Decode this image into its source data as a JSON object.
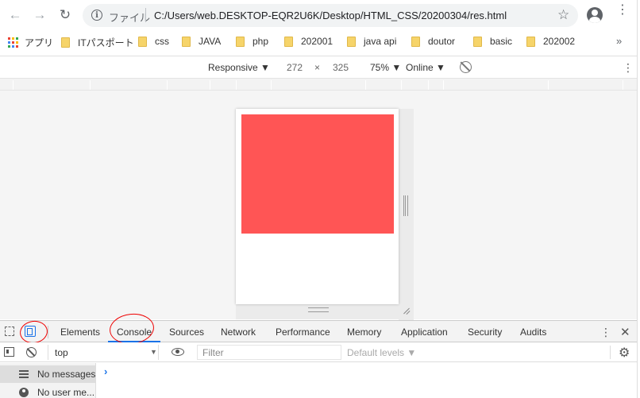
{
  "browser": {
    "scheme_label": "ファイル",
    "url": "C:/Users/web.DESKTOP-EQR2U6K/Desktop/HTML_CSS/20200304/res.html"
  },
  "bookmarks": [
    {
      "label": "アプリ",
      "type": "apps"
    },
    {
      "label": "ITパスポート",
      "type": "folder"
    },
    {
      "label": "css",
      "type": "folder"
    },
    {
      "label": "JAVA",
      "type": "folder"
    },
    {
      "label": "php",
      "type": "folder"
    },
    {
      "label": "202001",
      "type": "folder"
    },
    {
      "label": "java api",
      "type": "folder"
    },
    {
      "label": "doutor",
      "type": "folder"
    },
    {
      "label": "basic",
      "type": "folder"
    },
    {
      "label": "202002",
      "type": "folder"
    }
  ],
  "device_toolbar": {
    "device": "Responsive ▼",
    "width": "272",
    "times": "×",
    "height": "325",
    "zoom": "75% ▼",
    "network": "Online ▼"
  },
  "page_preview": {
    "box_color": "#ff5555"
  },
  "devtools": {
    "tabs": [
      "Elements",
      "Console",
      "Sources",
      "Network",
      "Performance",
      "Memory",
      "Application",
      "Security",
      "Audits"
    ],
    "active_tab": "Console"
  },
  "console": {
    "context": "top",
    "filter_placeholder": "Filter",
    "levels": "Default levels ▼",
    "sidebar": [
      {
        "label": "No messages",
        "icon": "list-icon"
      },
      {
        "label": "No user me...",
        "icon": "user-icon"
      }
    ],
    "prompt": "›"
  },
  "colors": {
    "accent": "#1a73e8",
    "annotation": "#ee0000"
  }
}
